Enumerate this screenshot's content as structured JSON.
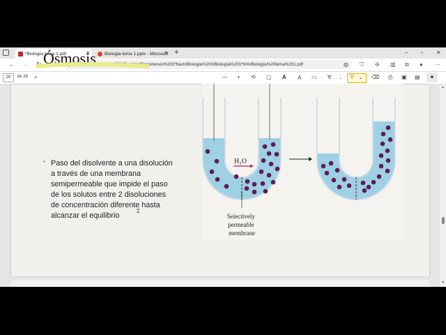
{
  "browser": {
    "tabs": [
      {
        "label": "*Biología tema 1.pdf",
        "icon": "pdf-icon",
        "active": true
      },
      {
        "label": "Biología tema 1.pptx - Microsoft",
        "icon": "powerpoint-icon",
        "active": false
      }
    ],
    "new_tab": "+",
    "window_controls": {
      "minimize": "–",
      "maximize": "▫",
      "close": "✕"
    },
    "address": {
      "label": "Archivo",
      "url": "C:/Users/34722/Desktop/Resúmenes%202ºbach/Biología%20II/Biología%201ºtrim/Biología%20tema%201.pdf"
    },
    "accent": "#e3b500"
  },
  "pdf_toolbar": {
    "page_current": "20",
    "page_total": "de 28",
    "zoom_out": "—",
    "zoom_in": "+",
    "highlight_color": "#e8d21a"
  },
  "slide": {
    "title": "Ósmosis",
    "bullet": "•",
    "text_lines": [
      "Paso del disolvente a una disolución",
      "a través de una membrana",
      "semipermeable que impide el paso",
      "de los solutos entre 2 disoluciones",
      "de concentración diferente hasta",
      "alcanzar el equilibrio"
    ],
    "figure": {
      "water_label": "H₂O",
      "membrane_label_lines": [
        "Selectively",
        "permeable",
        "membrane"
      ],
      "water_color": "#9ed0e6",
      "solute_color": "#5e1e4e"
    }
  }
}
